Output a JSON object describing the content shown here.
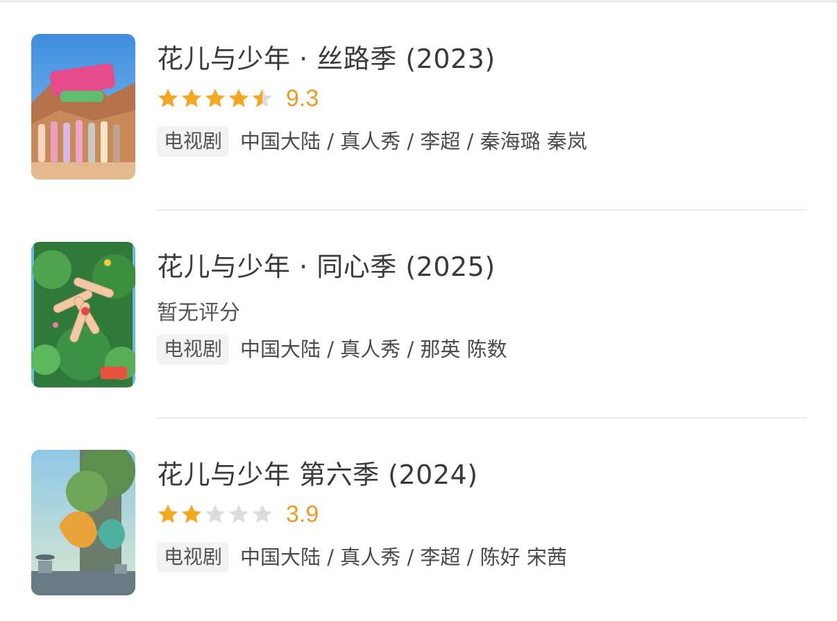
{
  "results": [
    {
      "title": "花儿与少年 · 丝路季 (2023)",
      "rating": {
        "has_rating": true,
        "stars": 4.5,
        "score": "9.3"
      },
      "no_rating_text": "",
      "tag": "电视剧",
      "meta": "中国大陆 / 真人秀 / 李超 / 秦海璐 秦岚",
      "poster_theme": "desert"
    },
    {
      "title": "花儿与少年 · 同心季 (2025)",
      "rating": {
        "has_rating": false,
        "stars": 0,
        "score": ""
      },
      "no_rating_text": "暂无评分",
      "tag": "电视剧",
      "meta": "中国大陆 / 真人秀 / 那英 陈数",
      "poster_theme": "jungle"
    },
    {
      "title": "花儿与少年 第六季 (2024)",
      "rating": {
        "has_rating": true,
        "stars": 2,
        "score": "3.9"
      },
      "no_rating_text": "",
      "tag": "电视剧",
      "meta": "中国大陆 / 真人秀 / 李超 / 陈好 宋茜",
      "poster_theme": "fantasy"
    }
  ],
  "colors": {
    "star_filled": "#f5a623",
    "star_empty": "#dddddd",
    "score": "#f09a24",
    "tag_bg": "#f2f2f2",
    "divider": "#ececec"
  }
}
